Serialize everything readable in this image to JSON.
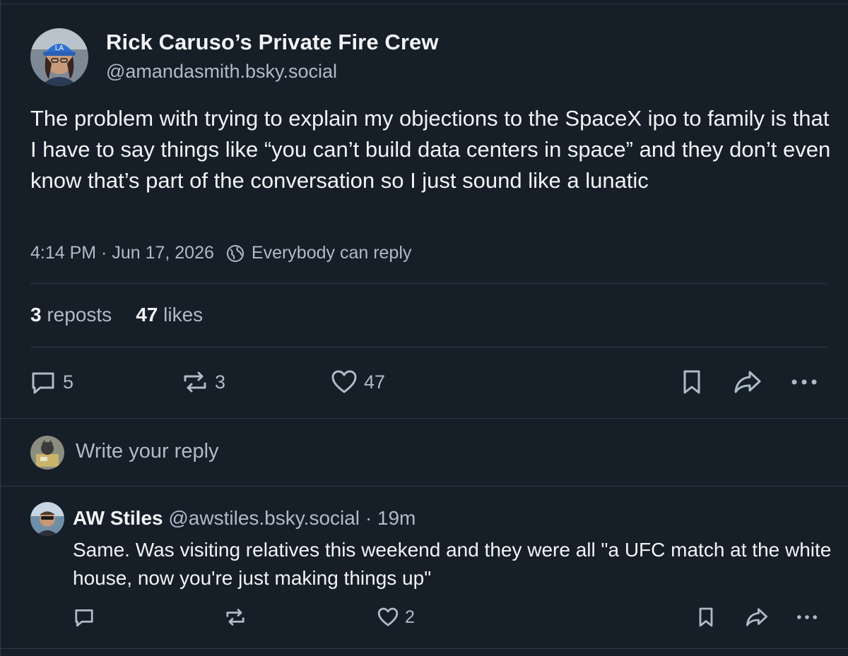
{
  "post": {
    "display_name": "Rick Caruso’s Private Fire Crew",
    "handle": "@amandasmith.bsky.social",
    "text": "The problem with trying to explain my objections to the SpaceX ipo to family is that I have to say things like “you can’t build data centers in space” and they don’t even know that’s part of the conversation so I just sound like a lunatic",
    "timestamp": "4:14 PM · Jun 17, 2026",
    "reply_setting": "Everybody can reply",
    "stats": {
      "reposts_count": "3",
      "reposts_label": "reposts",
      "likes_count": "47",
      "likes_label": "likes"
    },
    "actions": {
      "reply_count": "5",
      "repost_count": "3",
      "like_count": "47"
    }
  },
  "composer": {
    "placeholder": "Write your reply"
  },
  "reply": {
    "display_name": "AW Stiles",
    "handle": "@awstiles.bsky.social",
    "age": "· 19m",
    "text": "Same. Was visiting relatives this weekend and they were all \"a UFC match at the white house, now you're just making things up\"",
    "actions": {
      "like_count": "2"
    }
  },
  "colors": {
    "background": "#161e27",
    "border": "#2e3a48",
    "text_primary": "#f1f3f5",
    "text_secondary": "#aebbc9"
  }
}
